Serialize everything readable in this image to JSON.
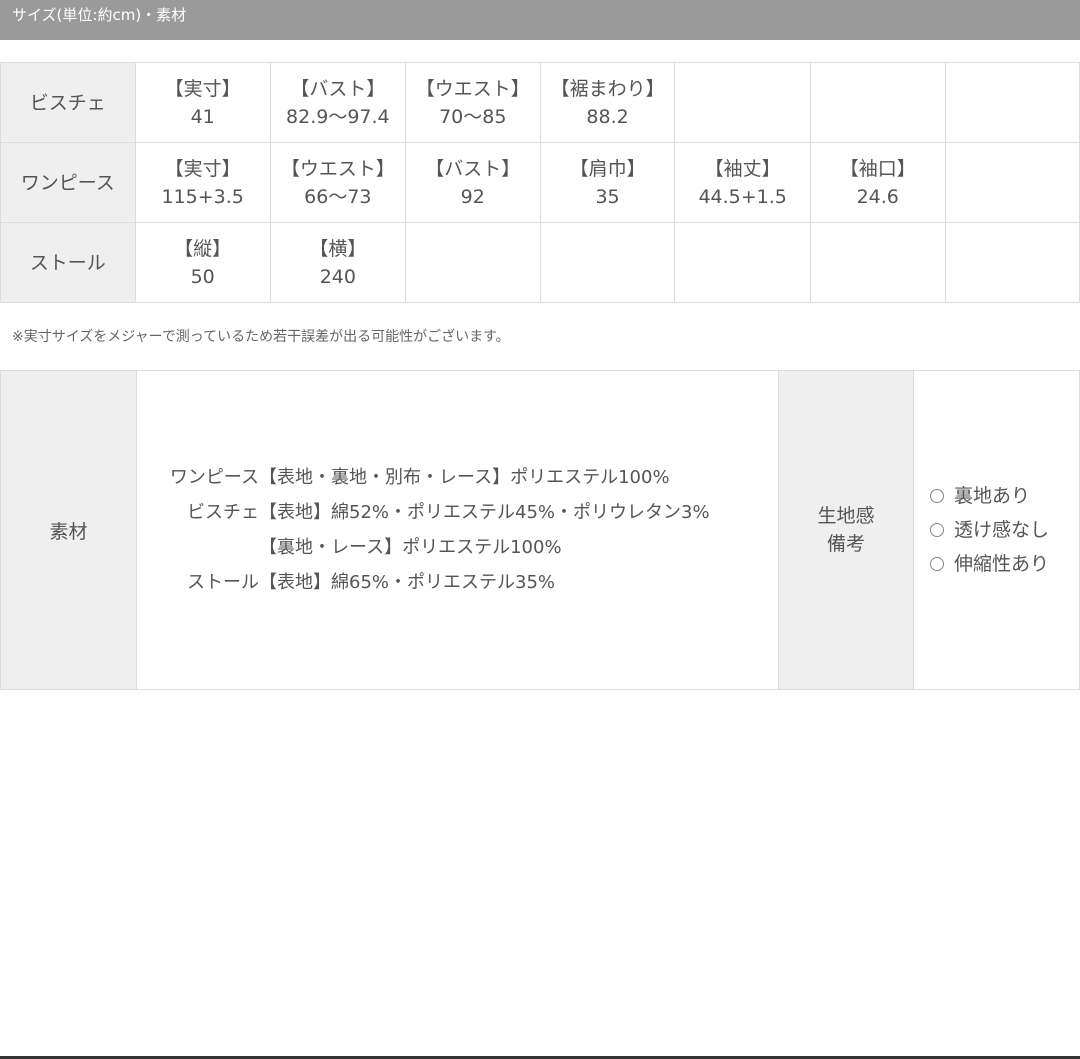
{
  "header": {
    "title": "サイズ(単位:約cm)・素材"
  },
  "size_table": {
    "rows": [
      {
        "name": "ビスチェ",
        "cells": [
          {
            "label": "【実寸】",
            "value": "41"
          },
          {
            "label": "【バスト】",
            "value": "82.9〜97.4"
          },
          {
            "label": "【ウエスト】",
            "value": "70〜85"
          },
          {
            "label": "【裾まわり】",
            "value": "88.2"
          },
          {
            "label": "",
            "value": ""
          },
          {
            "label": "",
            "value": ""
          },
          {
            "label": "",
            "value": ""
          }
        ]
      },
      {
        "name": "ワンピース",
        "cells": [
          {
            "label": "【実寸】",
            "value": "115+3.5"
          },
          {
            "label": "【ウエスト】",
            "value": "66〜73"
          },
          {
            "label": "【バスト】",
            "value": "92"
          },
          {
            "label": "【肩巾】",
            "value": "35"
          },
          {
            "label": "【袖丈】",
            "value": "44.5+1.5"
          },
          {
            "label": "【袖口】",
            "value": "24.6"
          },
          {
            "label": "",
            "value": ""
          }
        ]
      },
      {
        "name": "ストール",
        "cells": [
          {
            "label": "【縦】",
            "value": "50"
          },
          {
            "label": "【横】",
            "value": "240"
          },
          {
            "label": "",
            "value": ""
          },
          {
            "label": "",
            "value": ""
          },
          {
            "label": "",
            "value": ""
          },
          {
            "label": "",
            "value": ""
          },
          {
            "label": "",
            "value": ""
          }
        ]
      }
    ]
  },
  "note": "※実寸サイズをメジャーで測っているため若干誤差が出る可能性がございます。",
  "material": {
    "heading": "素材",
    "lines": [
      {
        "prefix": "ワンピース",
        "text": "【表地・裏地・別布・レース】ポリエステル100%"
      },
      {
        "prefix": "ビスチェ",
        "text": "【表地】綿52%・ポリエステル45%・ポリウレタン3%"
      },
      {
        "prefix": "",
        "text": "【裏地・レース】ポリエステル100%"
      },
      {
        "prefix": "ストール",
        "text": "【表地】綿65%・ポリエステル35%"
      }
    ],
    "feel_heading_1": "生地感",
    "feel_heading_2": "備考",
    "feel_items": [
      "裏地あり",
      "透け感なし",
      "伸縮性あり"
    ]
  }
}
